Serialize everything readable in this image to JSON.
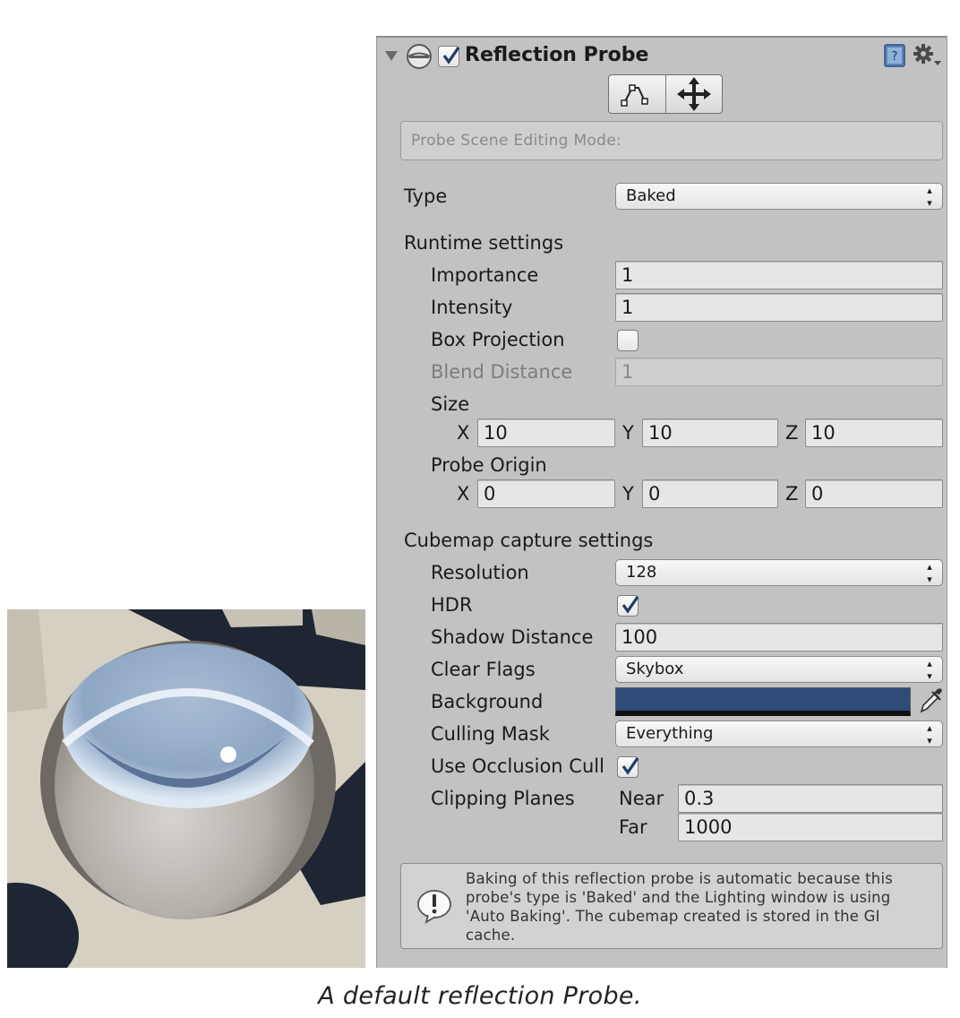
{
  "component": {
    "title": "Reflection Probe",
    "enabled": true,
    "icons": [
      "foldout-arrow-icon",
      "probe-sphere-icon",
      "help-book-icon",
      "gear-icon"
    ]
  },
  "scene_editing": {
    "label": "Probe Scene Editing Mode:",
    "tools": [
      "edit-bounds-icon",
      "move-origin-icon"
    ]
  },
  "type": {
    "label": "Type",
    "value": "Baked"
  },
  "runtime": {
    "header": "Runtime settings",
    "importance": {
      "label": "Importance",
      "value": "1"
    },
    "intensity": {
      "label": "Intensity",
      "value": "1"
    },
    "box_projection": {
      "label": "Box Projection",
      "checked": false
    },
    "blend_distance": {
      "label": "Blend Distance",
      "value": "1"
    },
    "size": {
      "label": "Size",
      "x": "10",
      "y": "10",
      "z": "10"
    },
    "probe_origin": {
      "label": "Probe Origin",
      "x": "0",
      "y": "0",
      "z": "0"
    },
    "axis_labels": {
      "x": "X",
      "y": "Y",
      "z": "Z"
    }
  },
  "cubemap": {
    "header": "Cubemap capture settings",
    "resolution": {
      "label": "Resolution",
      "value": "128"
    },
    "hdr": {
      "label": "HDR",
      "checked": true
    },
    "shadow_distance": {
      "label": "Shadow Distance",
      "value": "100"
    },
    "clear_flags": {
      "label": "Clear Flags",
      "value": "Skybox"
    },
    "background": {
      "label": "Background",
      "color": "#2f4b78"
    },
    "culling_mask": {
      "label": "Culling Mask",
      "value": "Everything"
    },
    "occlusion": {
      "label": "Use Occlusion Cull",
      "checked": true
    },
    "clipping": {
      "label": "Clipping Planes",
      "near_label": "Near",
      "near": "0.3",
      "far_label": "Far",
      "far": "1000"
    }
  },
  "help": {
    "text": "Baking of this reflection probe is automatic because this probe's type is 'Baked' and the Lighting window is using 'Auto Baking'. The cubemap created is stored in the GI cache."
  },
  "caption": "A default reflection Probe.",
  "colors": {
    "panel": "#c2c2c2",
    "checkmark": "#1f3a66",
    "background_swatch": "#2f4b78"
  }
}
